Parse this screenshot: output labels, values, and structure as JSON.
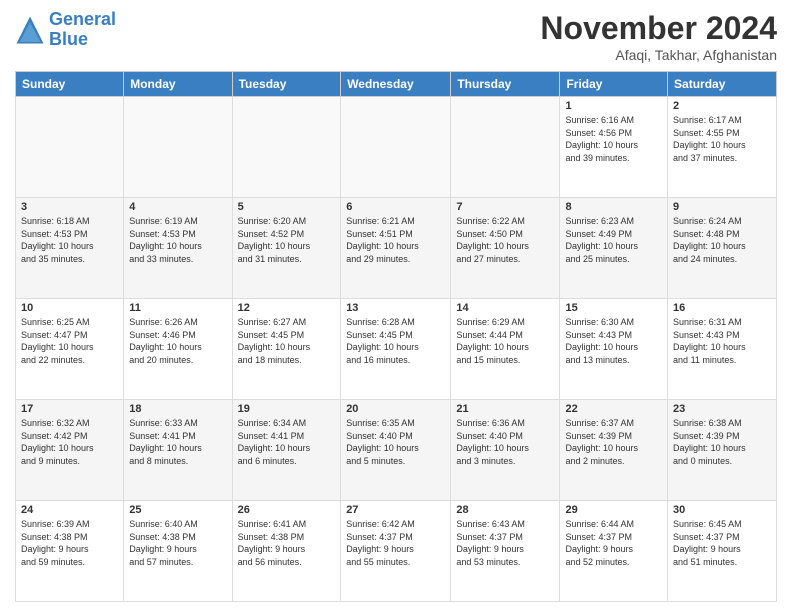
{
  "logo": {
    "line1": "General",
    "line2": "Blue"
  },
  "header": {
    "month": "November 2024",
    "location": "Afaqi, Takhar, Afghanistan"
  },
  "weekdays": [
    "Sunday",
    "Monday",
    "Tuesday",
    "Wednesday",
    "Thursday",
    "Friday",
    "Saturday"
  ],
  "weeks": [
    [
      {
        "day": "",
        "info": ""
      },
      {
        "day": "",
        "info": ""
      },
      {
        "day": "",
        "info": ""
      },
      {
        "day": "",
        "info": ""
      },
      {
        "day": "",
        "info": ""
      },
      {
        "day": "1",
        "info": "Sunrise: 6:16 AM\nSunset: 4:56 PM\nDaylight: 10 hours\nand 39 minutes."
      },
      {
        "day": "2",
        "info": "Sunrise: 6:17 AM\nSunset: 4:55 PM\nDaylight: 10 hours\nand 37 minutes."
      }
    ],
    [
      {
        "day": "3",
        "info": "Sunrise: 6:18 AM\nSunset: 4:53 PM\nDaylight: 10 hours\nand 35 minutes."
      },
      {
        "day": "4",
        "info": "Sunrise: 6:19 AM\nSunset: 4:53 PM\nDaylight: 10 hours\nand 33 minutes."
      },
      {
        "day": "5",
        "info": "Sunrise: 6:20 AM\nSunset: 4:52 PM\nDaylight: 10 hours\nand 31 minutes."
      },
      {
        "day": "6",
        "info": "Sunrise: 6:21 AM\nSunset: 4:51 PM\nDaylight: 10 hours\nand 29 minutes."
      },
      {
        "day": "7",
        "info": "Sunrise: 6:22 AM\nSunset: 4:50 PM\nDaylight: 10 hours\nand 27 minutes."
      },
      {
        "day": "8",
        "info": "Sunrise: 6:23 AM\nSunset: 4:49 PM\nDaylight: 10 hours\nand 25 minutes."
      },
      {
        "day": "9",
        "info": "Sunrise: 6:24 AM\nSunset: 4:48 PM\nDaylight: 10 hours\nand 24 minutes."
      }
    ],
    [
      {
        "day": "10",
        "info": "Sunrise: 6:25 AM\nSunset: 4:47 PM\nDaylight: 10 hours\nand 22 minutes."
      },
      {
        "day": "11",
        "info": "Sunrise: 6:26 AM\nSunset: 4:46 PM\nDaylight: 10 hours\nand 20 minutes."
      },
      {
        "day": "12",
        "info": "Sunrise: 6:27 AM\nSunset: 4:45 PM\nDaylight: 10 hours\nand 18 minutes."
      },
      {
        "day": "13",
        "info": "Sunrise: 6:28 AM\nSunset: 4:45 PM\nDaylight: 10 hours\nand 16 minutes."
      },
      {
        "day": "14",
        "info": "Sunrise: 6:29 AM\nSunset: 4:44 PM\nDaylight: 10 hours\nand 15 minutes."
      },
      {
        "day": "15",
        "info": "Sunrise: 6:30 AM\nSunset: 4:43 PM\nDaylight: 10 hours\nand 13 minutes."
      },
      {
        "day": "16",
        "info": "Sunrise: 6:31 AM\nSunset: 4:43 PM\nDaylight: 10 hours\nand 11 minutes."
      }
    ],
    [
      {
        "day": "17",
        "info": "Sunrise: 6:32 AM\nSunset: 4:42 PM\nDaylight: 10 hours\nand 9 minutes."
      },
      {
        "day": "18",
        "info": "Sunrise: 6:33 AM\nSunset: 4:41 PM\nDaylight: 10 hours\nand 8 minutes."
      },
      {
        "day": "19",
        "info": "Sunrise: 6:34 AM\nSunset: 4:41 PM\nDaylight: 10 hours\nand 6 minutes."
      },
      {
        "day": "20",
        "info": "Sunrise: 6:35 AM\nSunset: 4:40 PM\nDaylight: 10 hours\nand 5 minutes."
      },
      {
        "day": "21",
        "info": "Sunrise: 6:36 AM\nSunset: 4:40 PM\nDaylight: 10 hours\nand 3 minutes."
      },
      {
        "day": "22",
        "info": "Sunrise: 6:37 AM\nSunset: 4:39 PM\nDaylight: 10 hours\nand 2 minutes."
      },
      {
        "day": "23",
        "info": "Sunrise: 6:38 AM\nSunset: 4:39 PM\nDaylight: 10 hours\nand 0 minutes."
      }
    ],
    [
      {
        "day": "24",
        "info": "Sunrise: 6:39 AM\nSunset: 4:38 PM\nDaylight: 9 hours\nand 59 minutes."
      },
      {
        "day": "25",
        "info": "Sunrise: 6:40 AM\nSunset: 4:38 PM\nDaylight: 9 hours\nand 57 minutes."
      },
      {
        "day": "26",
        "info": "Sunrise: 6:41 AM\nSunset: 4:38 PM\nDaylight: 9 hours\nand 56 minutes."
      },
      {
        "day": "27",
        "info": "Sunrise: 6:42 AM\nSunset: 4:37 PM\nDaylight: 9 hours\nand 55 minutes."
      },
      {
        "day": "28",
        "info": "Sunrise: 6:43 AM\nSunset: 4:37 PM\nDaylight: 9 hours\nand 53 minutes."
      },
      {
        "day": "29",
        "info": "Sunrise: 6:44 AM\nSunset: 4:37 PM\nDaylight: 9 hours\nand 52 minutes."
      },
      {
        "day": "30",
        "info": "Sunrise: 6:45 AM\nSunset: 4:37 PM\nDaylight: 9 hours\nand 51 minutes."
      }
    ]
  ]
}
